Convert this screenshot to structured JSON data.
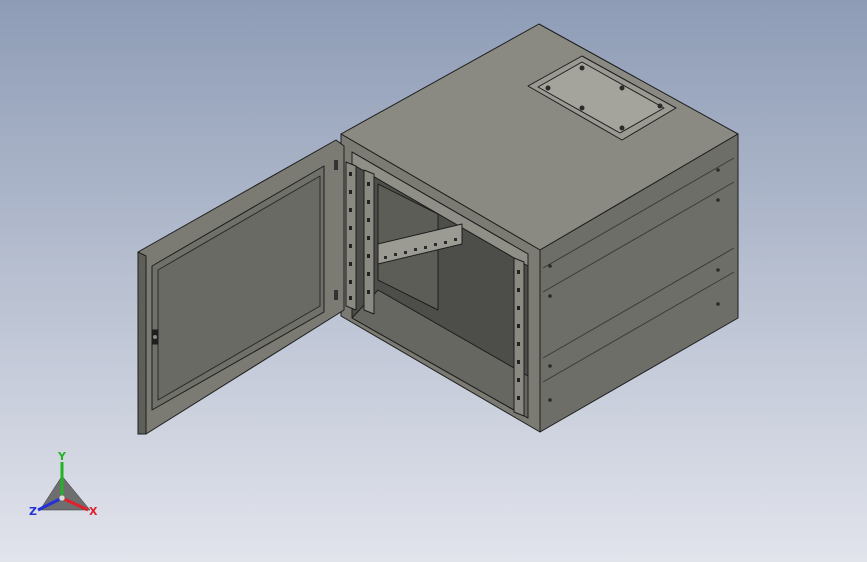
{
  "viewport": {
    "background_top": "#8e9cb6",
    "background_bottom": "#e2e4ec",
    "model": {
      "name": "wall-mount-rack-cabinet",
      "door": "open",
      "body_colors": {
        "top": "#8a8a82",
        "right_side": "#6d6e67",
        "front_frame": "#7b7b74",
        "interior": "#4d4e49",
        "door_panel": "#6f7069",
        "edge": "#1d1d1d"
      }
    }
  },
  "triad": {
    "x_label": "X",
    "y_label": "Y",
    "z_label": "Z",
    "x_color": "#e0202a",
    "y_color": "#24b324",
    "z_color": "#2430d8"
  }
}
